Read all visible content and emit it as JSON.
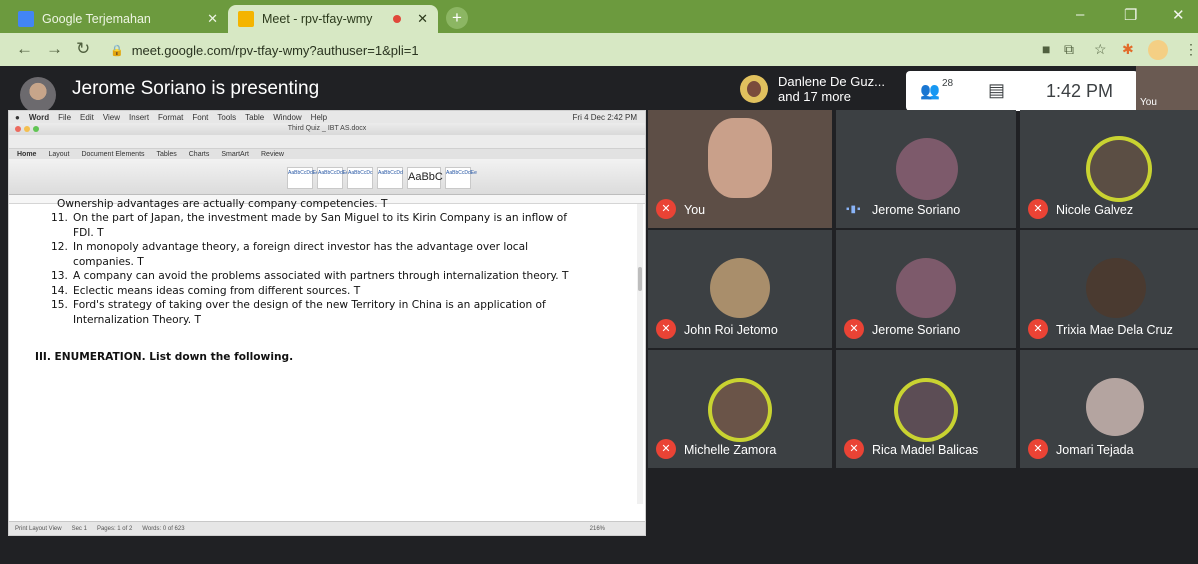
{
  "browser": {
    "tabs": [
      {
        "label": "Google Terjemahan",
        "favicon_color": "#4285f4",
        "active": false
      },
      {
        "label": "Meet - rpv-tfay-wmy",
        "favicon_color": "#f4b400",
        "active": true
      }
    ],
    "new_tab": "+",
    "window": {
      "minimize": "–",
      "restore": "❐",
      "close": "✕"
    },
    "url": "meet.google.com/rpv-tfay-wmy?authuser=1&pli=1",
    "accent": "#6c9a3e"
  },
  "meet": {
    "presenter_text": "Jerome Soriano is presenting",
    "joiner_text_1": "Danlene De Guz...",
    "joiner_text_2": "and 17 more",
    "participant_count": "28",
    "time": "1:42 PM",
    "self_label": "You",
    "participants": [
      {
        "name": "You",
        "muted": true
      },
      {
        "name": "Jerome Soriano",
        "muted": false
      },
      {
        "name": "Nicole Galvez",
        "muted": true
      },
      {
        "name": "John Roi Jetomo",
        "muted": true
      },
      {
        "name": "Jerome Soriano",
        "muted": true
      },
      {
        "name": "Trixia Mae Dela Cruz",
        "muted": true
      },
      {
        "name": "Michelle Zamora",
        "muted": true
      },
      {
        "name": "Rica Madel Balicas",
        "muted": true
      },
      {
        "name": "Jomari Tejada",
        "muted": true
      }
    ]
  },
  "word": {
    "menu": [
      "Word",
      "File",
      "Edit",
      "View",
      "Insert",
      "Format",
      "Font",
      "Tools",
      "Table",
      "Window",
      "Help"
    ],
    "menu_right": "Fri 4 Dec 2:42 PM",
    "doc_title": "Third Quiz _ IBT AS.docx",
    "ribbon_tabs": [
      "Home",
      "Layout",
      "Document Elements",
      "Tables",
      "Charts",
      "SmartArt",
      "Review"
    ],
    "style_samples": [
      "AaBbCcDdEe",
      "AaBbCcDdEe",
      "AaBbCcDc",
      "AaBbCcDd",
      "AaBbC",
      "AaBbCcDdEe"
    ],
    "clipped_line": "Ownership advantages are actually company competencies. T",
    "items": [
      {
        "num": "11.",
        "text": "On the part of Japan, the investment made by San Miguel to its Kirin Company is an inflow of FDI. T"
      },
      {
        "num": "12.",
        "text": "In monopoly advantage theory, a foreign direct investor has the advantage over local companies. T"
      },
      {
        "num": "13.",
        "text": "A company can avoid the problems associated with partners through internalization theory. T"
      },
      {
        "num": "14.",
        "text": "Eclectic means ideas coming from different sources. T"
      },
      {
        "num": "15.",
        "text": "Ford's strategy of taking over the design of the new Territory in China is an application of Internalization Theory. T"
      }
    ],
    "section_heading": "III. ENUMERATION. List down the following.",
    "status": {
      "view": "Print Layout View",
      "sec": "Sec 1",
      "pages": "Pages: 1 of 2",
      "words": "Words: 0 of 623",
      "zoom": "216%"
    }
  }
}
